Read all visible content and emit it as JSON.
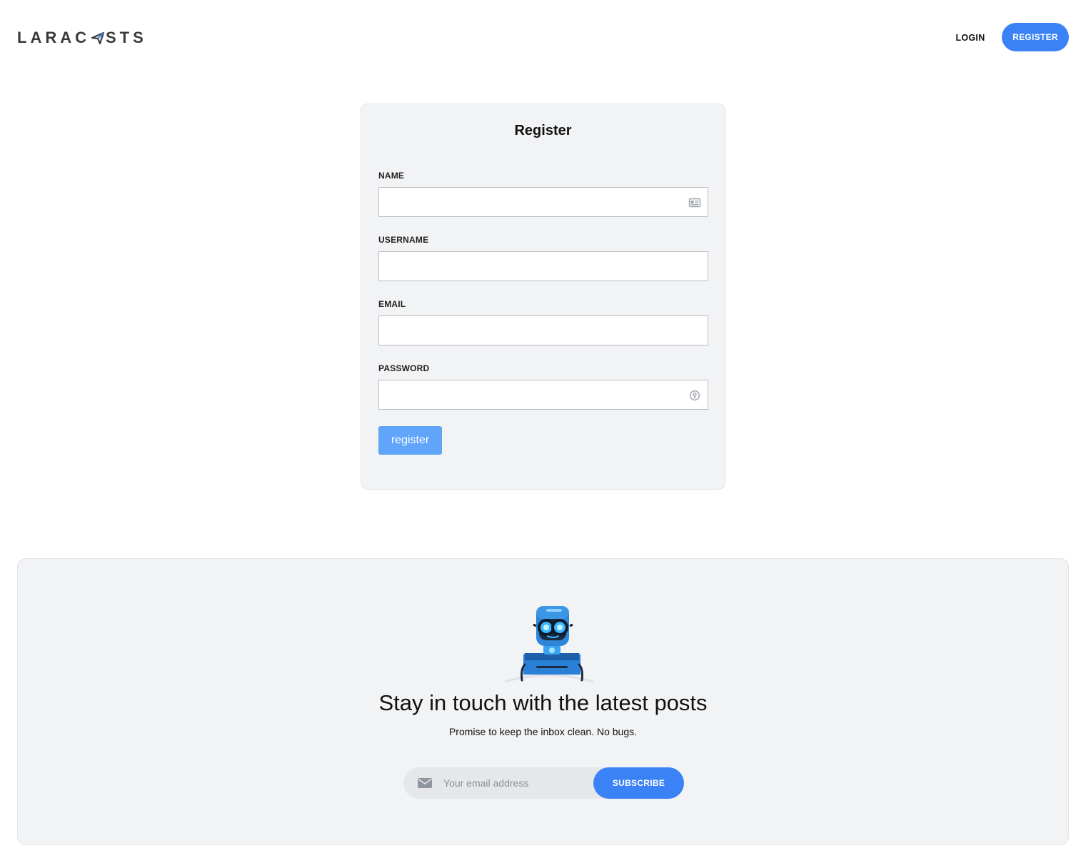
{
  "header": {
    "logo_text_left": "LARAC",
    "logo_text_right": "STS",
    "login_label": "LOGIN",
    "register_label": "REGISTER"
  },
  "form": {
    "title": "Register",
    "fields": [
      {
        "label": "NAME",
        "value": "",
        "icon": "contact-card-icon"
      },
      {
        "label": "USERNAME",
        "value": ""
      },
      {
        "label": "EMAIL",
        "value": ""
      },
      {
        "label": "PASSWORD",
        "value": "",
        "icon": "password-manager-icon"
      }
    ],
    "submit_label": "register"
  },
  "newsletter": {
    "title": "Stay in touch with the latest posts",
    "subtitle": "Promise to keep the inbox clean. No bugs.",
    "email_placeholder": "Your email address",
    "subscribe_label": "SUBSCRIBE",
    "mascot": "robot-with-glasses"
  },
  "colors": {
    "accent": "#3b82f6",
    "button_light": "#60a5fa",
    "panel_bg": "#f2f3f5"
  }
}
